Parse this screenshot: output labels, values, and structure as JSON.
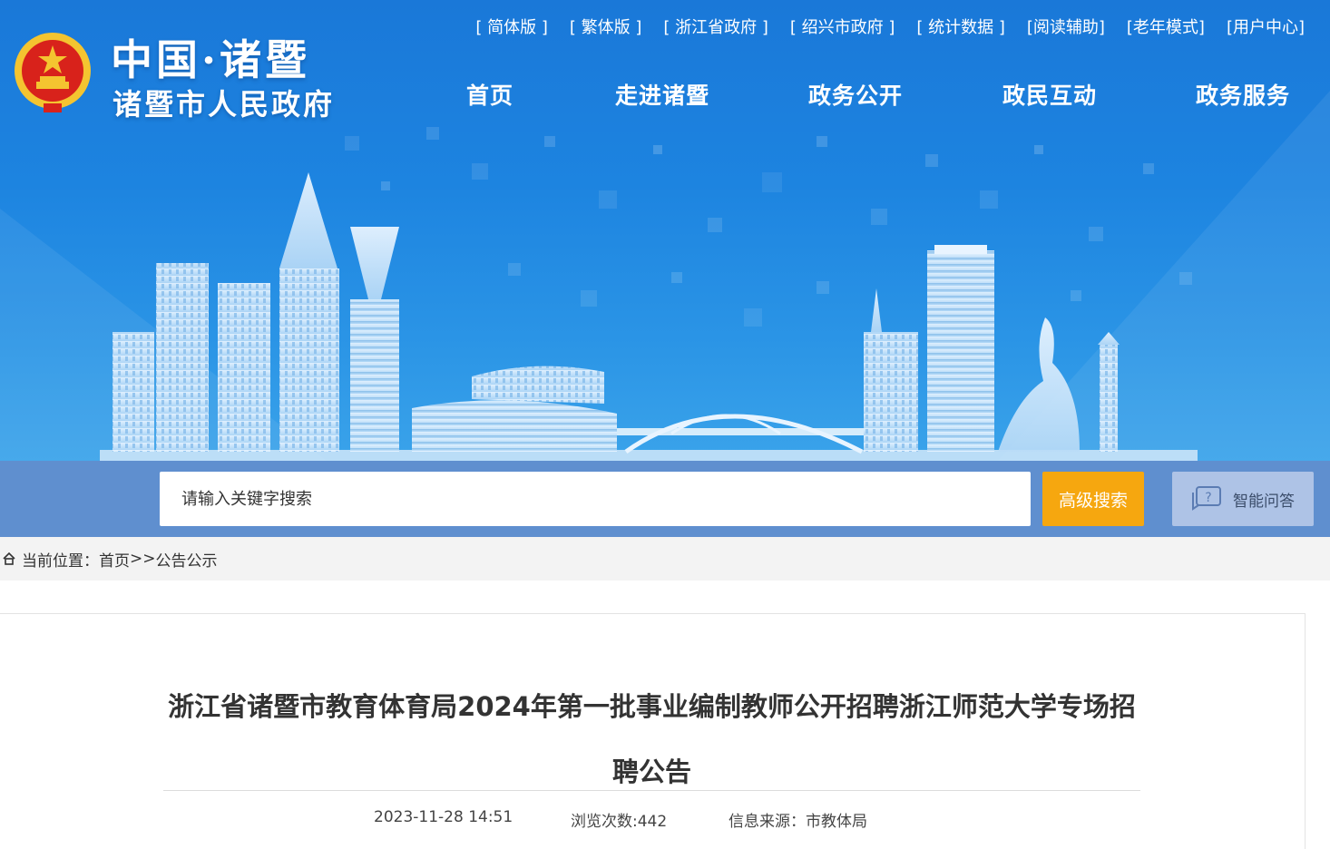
{
  "site": {
    "title_main": "中国·诸暨",
    "title_sub": "诸暨市人民政府",
    "emblem": "national-emblem"
  },
  "top_links": [
    "[ 简体版 ]",
    "[ 繁体版 ]",
    "[ 浙江省政府 ]",
    "[ 绍兴市政府 ]",
    "[ 统计数据 ]",
    "[阅读辅助]",
    "[老年模式]",
    "[用户中心]"
  ],
  "nav": [
    "首页",
    "走进诸暨",
    "政务公开",
    "政民互动",
    "政务服务"
  ],
  "search": {
    "placeholder": "请输入关键字搜索",
    "button_label": "高级搜索",
    "ai_label": "智能问答",
    "ai_icon": "chat-question-icon"
  },
  "breadcrumb": {
    "icon": "home-icon",
    "prefix": "当前位置：",
    "home": "首页",
    "sep": ">>",
    "current": "公告公示"
  },
  "article": {
    "title": "浙江省诸暨市教育体育局2024年第一批事业编制教师公开招聘浙江师范大学专场招聘公告",
    "date": "2023-11-28 14:51",
    "views": "浏览次数:442",
    "source_label": "信息来源：",
    "source": "市教体局"
  },
  "colors": {
    "banner_blue": "#1d84e0",
    "search_strip": "#5f8fcf",
    "search_button": "#f6a70f",
    "ai_button": "#aec3e6"
  }
}
